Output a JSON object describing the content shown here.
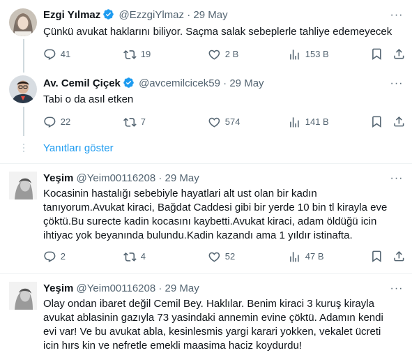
{
  "tweets": [
    {
      "name": "Ezgi Yılmaz",
      "handle": "@EzzgiYlmaz",
      "dot": "·",
      "date": "29 May",
      "verified": true,
      "text": "Çünkü avukat haklarını biliyor. Saçma salak sebeplerle tahliye edemeyecek",
      "replies": "41",
      "retweets": "19",
      "likes": "2 B",
      "views": "153 B"
    },
    {
      "name": "Av. Cemil Çiçek",
      "handle": "@avcemilcicek59",
      "dot": "·",
      "date": "29 May",
      "verified": true,
      "text": "Tabi o da asıl etken",
      "replies": "22",
      "retweets": "7",
      "likes": "574",
      "views": "141 B"
    },
    {
      "name": "Yeşim",
      "handle": "@Yeim00116208",
      "dot": "·",
      "date": "29 May",
      "verified": false,
      "text": "Kocasinin hastalığı sebebiyle hayatlari alt ust olan bir kadın\ntanıyorum.Avukat kiraci, Bağdat Caddesi gibi bir yerde 10 bin tl kirayla eve\nçöktü.Bu surecte kadin kocasını kaybetti.Avukat kiraci, adam öldüğü icin\nihtiyac yok beyanında bulundu.Kadin kazandı ama 1 yıldır istinafta.",
      "replies": "2",
      "retweets": "4",
      "likes": "52",
      "views": "47 B"
    },
    {
      "name": "Yeşim",
      "handle": "@Yeim00116208",
      "dot": "·",
      "date": "29 May",
      "verified": false,
      "text": "Olay ondan ibaret değil Cemil Bey. Haklılar. Benim kiraci 3 kuruş kirayla\navukat ablasinin gazıyla 73 yasindaki annemin evine çöktü. Adamın kendi\nevi var! Ve bu avukat abla, kesinlesmis yargi karari yokken, vekalet ücreti\nicin  hırs kin ve nefretle emekli maasima haciz koydurdu!"
    }
  ],
  "show_replies_label": "Yanıtları göster",
  "colors": {
    "accent": "#1d9bf0",
    "muted": "#536471",
    "text": "#0f1419",
    "line": "#cfd9de"
  }
}
